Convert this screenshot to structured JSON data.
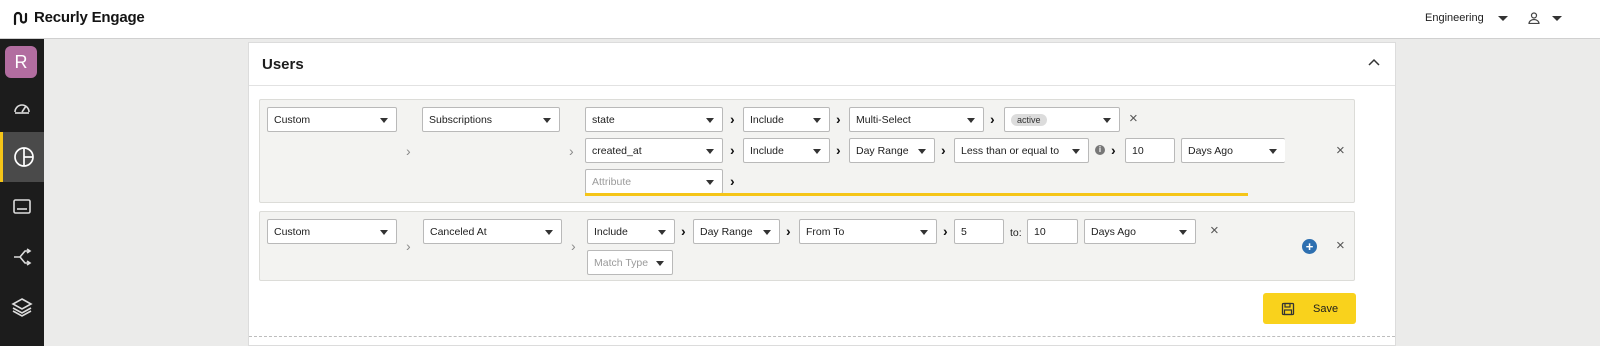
{
  "app": {
    "name": "Recurly Engage",
    "brand_color": "#141414",
    "accent": "#f5c518"
  },
  "header": {
    "org": "Engineering",
    "user_icon": "user-icon"
  },
  "sidebar": {
    "avatar_letter": "R",
    "items": [
      {
        "icon": "dashboard-gauge-icon"
      },
      {
        "icon": "segments-pie-icon",
        "active": true
      },
      {
        "icon": "display-icon"
      },
      {
        "icon": "flows-icon"
      },
      {
        "icon": "layers-icon"
      }
    ]
  },
  "panel": {
    "title": "Users"
  },
  "group1": {
    "type": "Custom",
    "source": "Subscriptions",
    "rows": [
      {
        "attribute": "state",
        "operator": "Include",
        "mode": "Multi-Select",
        "value_chip": "active"
      },
      {
        "attribute": "created_at",
        "operator": "Include",
        "mode": "Day Range",
        "comparison": "Less than or equal to",
        "value": "10",
        "unit": "Days Ago"
      }
    ],
    "attribute_placeholder": "Attribute"
  },
  "group2": {
    "type": "Custom",
    "source": "Canceled At",
    "operator": "Include",
    "mode": "Day Range",
    "range": "From To",
    "from": "5",
    "to_label": "to:",
    "to": "10",
    "unit": "Days Ago",
    "match_placeholder": "Match Type"
  },
  "actions": {
    "save_label": "Save"
  }
}
